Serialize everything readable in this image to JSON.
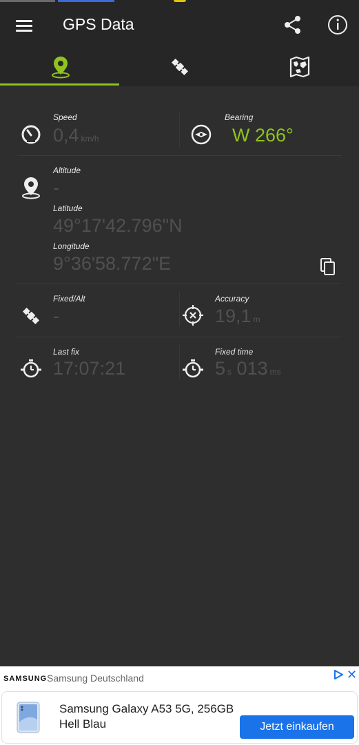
{
  "app": {
    "title": "GPS Data"
  },
  "tabs": [
    {
      "name": "location",
      "icon": "location-pin-icon",
      "active": true
    },
    {
      "name": "satellites",
      "icon": "satellite-icon",
      "active": false
    },
    {
      "name": "map",
      "icon": "map-icon",
      "active": false
    }
  ],
  "colors": {
    "accent": "#8fc31f",
    "background": "#2e2e2e",
    "bar": "#262626",
    "cta": "#1a73e8"
  },
  "speed": {
    "label": "Speed",
    "value": "0,4",
    "unit": "km/h"
  },
  "bearing": {
    "label": "Bearing",
    "value": "W 266°"
  },
  "altitude": {
    "label": "Altitude",
    "value": "-"
  },
  "latitude": {
    "label": "Latitude",
    "value": "49°17'42.796\"N"
  },
  "longitude": {
    "label": "Longitude",
    "value": "9°36'58.772\"E"
  },
  "fixed_alt": {
    "label": "Fixed/Alt",
    "value": "-"
  },
  "accuracy": {
    "label": "Accuracy",
    "value": "19,1",
    "unit": "m"
  },
  "last_fix": {
    "label": "Last fix",
    "value": "17:07:21"
  },
  "fixed_time": {
    "label": "Fixed time",
    "sec": "5",
    "sec_unit": "s",
    "ms": "013",
    "ms_unit": "ms"
  },
  "ad": {
    "brand": "SAMSUNG",
    "advertiser": "Samsung Deutschland",
    "title": "Samsung Galaxy A53 5G, 256GB Hell Blau",
    "cta": "Jetzt einkaufen",
    "close": "✕"
  }
}
